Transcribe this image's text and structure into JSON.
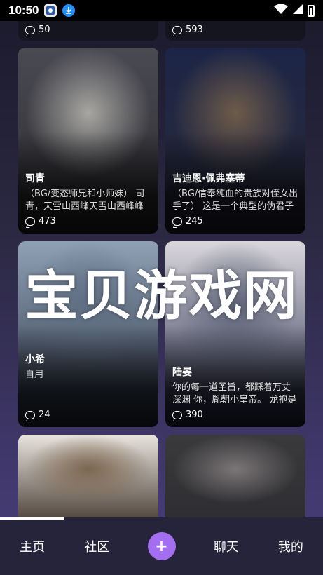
{
  "status_bar": {
    "time": "10:50",
    "app_icon_1": "app-icon",
    "app_icon_2": "download-icon"
  },
  "feed": {
    "partial_top_left": {
      "count": "50"
    },
    "partial_top_right": {
      "count": "593"
    },
    "cards": [
      {
        "name": "司青",
        "desc": "（BG/变态师兄和小师妹） 司青，天雪山西峰天雪山西峰峰主司义天的…",
        "count": "473",
        "palette": [
          "#4a4a52",
          "#a7a6a2",
          "#2b2a2e"
        ]
      },
      {
        "name": "吉迪恩·佩弗塞蒂",
        "desc": "（BG/信奉纯血的贵族对侄女出手了） 这是一个典型的伪君子与道貌岸然…",
        "count": "245",
        "palette": [
          "#1c2546",
          "#6d5b4a",
          "#2c2c3c"
        ]
      },
      {
        "name": "小希",
        "desc": "自用",
        "count": "24",
        "palette": [
          "#8fa0b5",
          "#5f6e82",
          "#2c3545"
        ]
      },
      {
        "name": "陆晏",
        "desc": "你的每一道圣旨，都踩着万丈深渊 你，胤朝小皇帝。 龙袍是你的铠甲，…",
        "count": "390",
        "palette": [
          "#d9d6dc",
          "#5d6478",
          "#2a3050"
        ]
      },
      {
        "name": "",
        "desc": "",
        "count": "",
        "palette": [
          "#e8e4de",
          "#7d6650",
          "#3a2e24"
        ]
      },
      {
        "name": "",
        "desc": "",
        "count": "",
        "palette": [
          "#3a3a3c",
          "#7b7677",
          "#2c2c30"
        ]
      }
    ]
  },
  "watermark": "宝贝游戏网",
  "tabbar": {
    "tabs": [
      "主页",
      "社区",
      "聊天",
      "我的"
    ],
    "add_label": "+",
    "accent": "#a46ef0"
  }
}
